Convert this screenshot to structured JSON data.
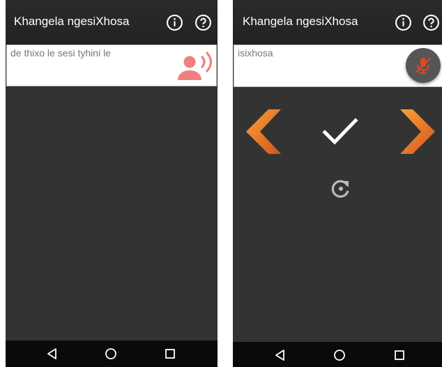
{
  "left_screen": {
    "title": "Khangela ngesiXhosa",
    "input_text": "de thixo le sesi tyhini le",
    "icons": {
      "info": "info-icon",
      "help": "help-icon",
      "voice": "speaking-person-icon"
    }
  },
  "right_screen": {
    "title": "Khangela ngesiXhosa",
    "input_text": "isixhosa",
    "icons": {
      "info": "info-icon",
      "help": "help-icon",
      "mic": "mic-off-icon",
      "prev": "chevron-left-icon",
      "confirm": "check-icon",
      "next": "chevron-right-icon",
      "retry": "refresh-icon"
    }
  },
  "navbar": {
    "back": "back-icon",
    "home": "home-icon",
    "recents": "recents-icon"
  },
  "colors": {
    "background": "#333333",
    "appbar": "#262626",
    "accent_orange": "#e8691e",
    "voice_icon": "#f08080",
    "mic_fab": "#555555",
    "navbar": "#0a0a0a"
  }
}
